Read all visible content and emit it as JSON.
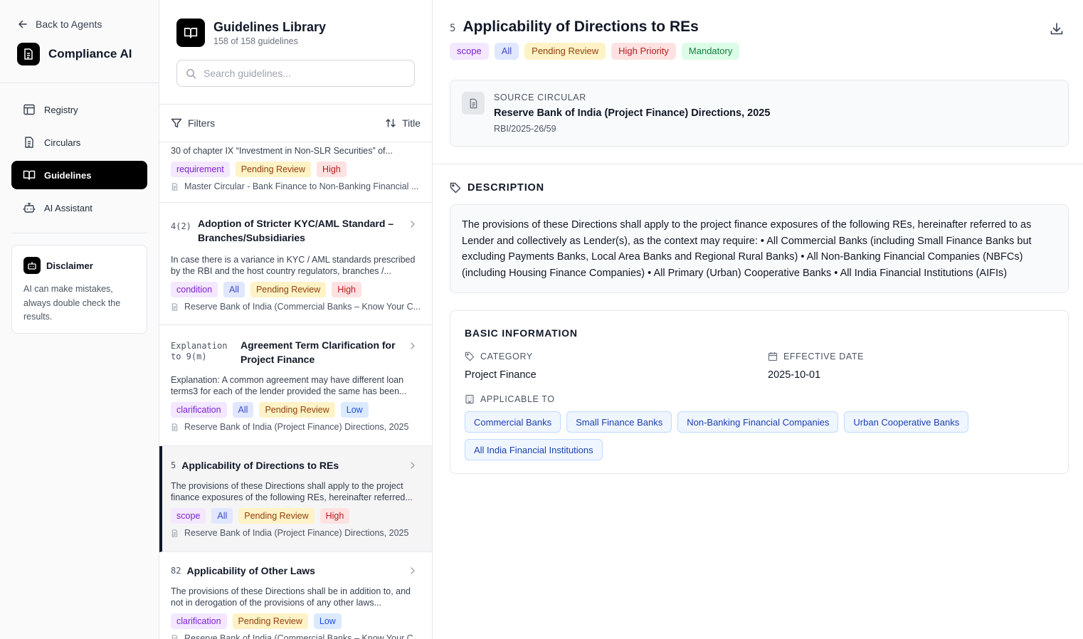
{
  "sidebar": {
    "back_label": "Back to Agents",
    "brand": "Compliance AI",
    "nav": [
      {
        "label": "Registry",
        "icon": "table-icon"
      },
      {
        "label": "Circulars",
        "icon": "document-icon"
      },
      {
        "label": "Guidelines",
        "icon": "book-open-icon",
        "active": true
      },
      {
        "label": "AI Assistant",
        "icon": "bot-icon"
      }
    ],
    "disclaimer": {
      "title": "Disclaimer",
      "text": "AI can make mistakes, always double check the results."
    }
  },
  "library": {
    "title": "Guidelines Library",
    "count": "158 of 158 guidelines",
    "search_placeholder": "Search guidelines...",
    "filters_label": "Filters",
    "sort_label": "Title",
    "items": [
      {
        "num": "",
        "title": "",
        "desc": "30 of chapter IX “Investment in Non-SLR Securities” of...",
        "tags": [
          {
            "text": "requirement",
            "color": "purple"
          },
          {
            "text": "Pending Review",
            "color": "yellow"
          },
          {
            "text": "High",
            "color": "red"
          }
        ],
        "source": "Master Circular - Bank Finance to Non-Banking Financial ..."
      },
      {
        "num": "4(2)",
        "title": "Adoption of Stricter KYC/AML Standard – Branches/Subsidiaries",
        "desc": "In case there is a variance in KYC / AML standards prescribed by the RBI and the host country regulators, branches /...",
        "tags": [
          {
            "text": "condition",
            "color": "purple"
          },
          {
            "text": "All",
            "color": "blue"
          },
          {
            "text": "Pending Review",
            "color": "yellow"
          },
          {
            "text": "High",
            "color": "red"
          }
        ],
        "source": "Reserve Bank of India (Commercial Banks – Know Your C..."
      },
      {
        "num": "Explanation to 9(m)",
        "title": "Agreement Term Clarification for Project Finance",
        "desc": "Explanation: A common agreement may have different loan terms3 for each of the lender provided the same has been...",
        "tags": [
          {
            "text": "clarification",
            "color": "purple"
          },
          {
            "text": "All",
            "color": "blue"
          },
          {
            "text": "Pending Review",
            "color": "yellow"
          },
          {
            "text": "Low",
            "color": "lowblue"
          }
        ],
        "source": "Reserve Bank of India (Project Finance) Directions, 2025"
      },
      {
        "num": "5",
        "title": "Applicability of Directions to REs",
        "desc": "The provisions of these Directions shall apply to the project finance exposures of the following REs, hereinafter referred...",
        "tags": [
          {
            "text": "scope",
            "color": "purple"
          },
          {
            "text": "All",
            "color": "blue"
          },
          {
            "text": "Pending Review",
            "color": "yellow"
          },
          {
            "text": "High",
            "color": "red"
          }
        ],
        "source": "Reserve Bank of India (Project Finance) Directions, 2025"
      },
      {
        "num": "82",
        "title": "Applicability of Other Laws",
        "desc": "The provisions of these Directions shall be in addition to, and not in derogation of the provisions of any other laws...",
        "tags": [
          {
            "text": "clarification",
            "color": "purple"
          },
          {
            "text": "Pending Review",
            "color": "yellow"
          },
          {
            "text": "Low",
            "color": "lowblue"
          }
        ],
        "source": "Reserve Bank of India (Commercial Banks – Know Your C..."
      }
    ]
  },
  "detail": {
    "num": "5",
    "title": "Applicability of Directions to REs",
    "tags": [
      {
        "text": "scope",
        "color": "purple"
      },
      {
        "text": "All",
        "color": "blue"
      },
      {
        "text": "Pending Review",
        "color": "yellow"
      },
      {
        "text": "High Priority",
        "color": "red"
      },
      {
        "text": "Mandatory",
        "color": "green"
      }
    ],
    "source_label": "SOURCE CIRCULAR",
    "source_name": "Reserve Bank of India (Project Finance) Directions, 2025",
    "source_id": "RBI/2025-26/59",
    "description_label": "DESCRIPTION",
    "description": "The provisions of these Directions shall apply to the project finance exposures of the following REs, hereinafter referred to as Lender and collectively as Lender(s), as the context may require: • All Commercial Banks (including Small Finance Banks but excluding Payments Banks, Local Area Banks and Regional Rural Banks) • All Non-Banking Financial Companies (NBFCs) (including Housing Finance Companies) • All Primary (Urban) Cooperative Banks • All India Financial Institutions (AIFIs)",
    "basic_info_label": "BASIC INFORMATION",
    "category_label": "CATEGORY",
    "category": "Project Finance",
    "effective_date_label": "EFFECTIVE DATE",
    "effective_date": "2025-10-01",
    "applicable_label": "APPLICABLE TO",
    "applicable_to": [
      "Commercial Banks",
      "Small Finance Banks",
      "Non-Banking Financial Companies",
      "Urban Cooperative Banks",
      "All India Financial Institutions"
    ]
  }
}
